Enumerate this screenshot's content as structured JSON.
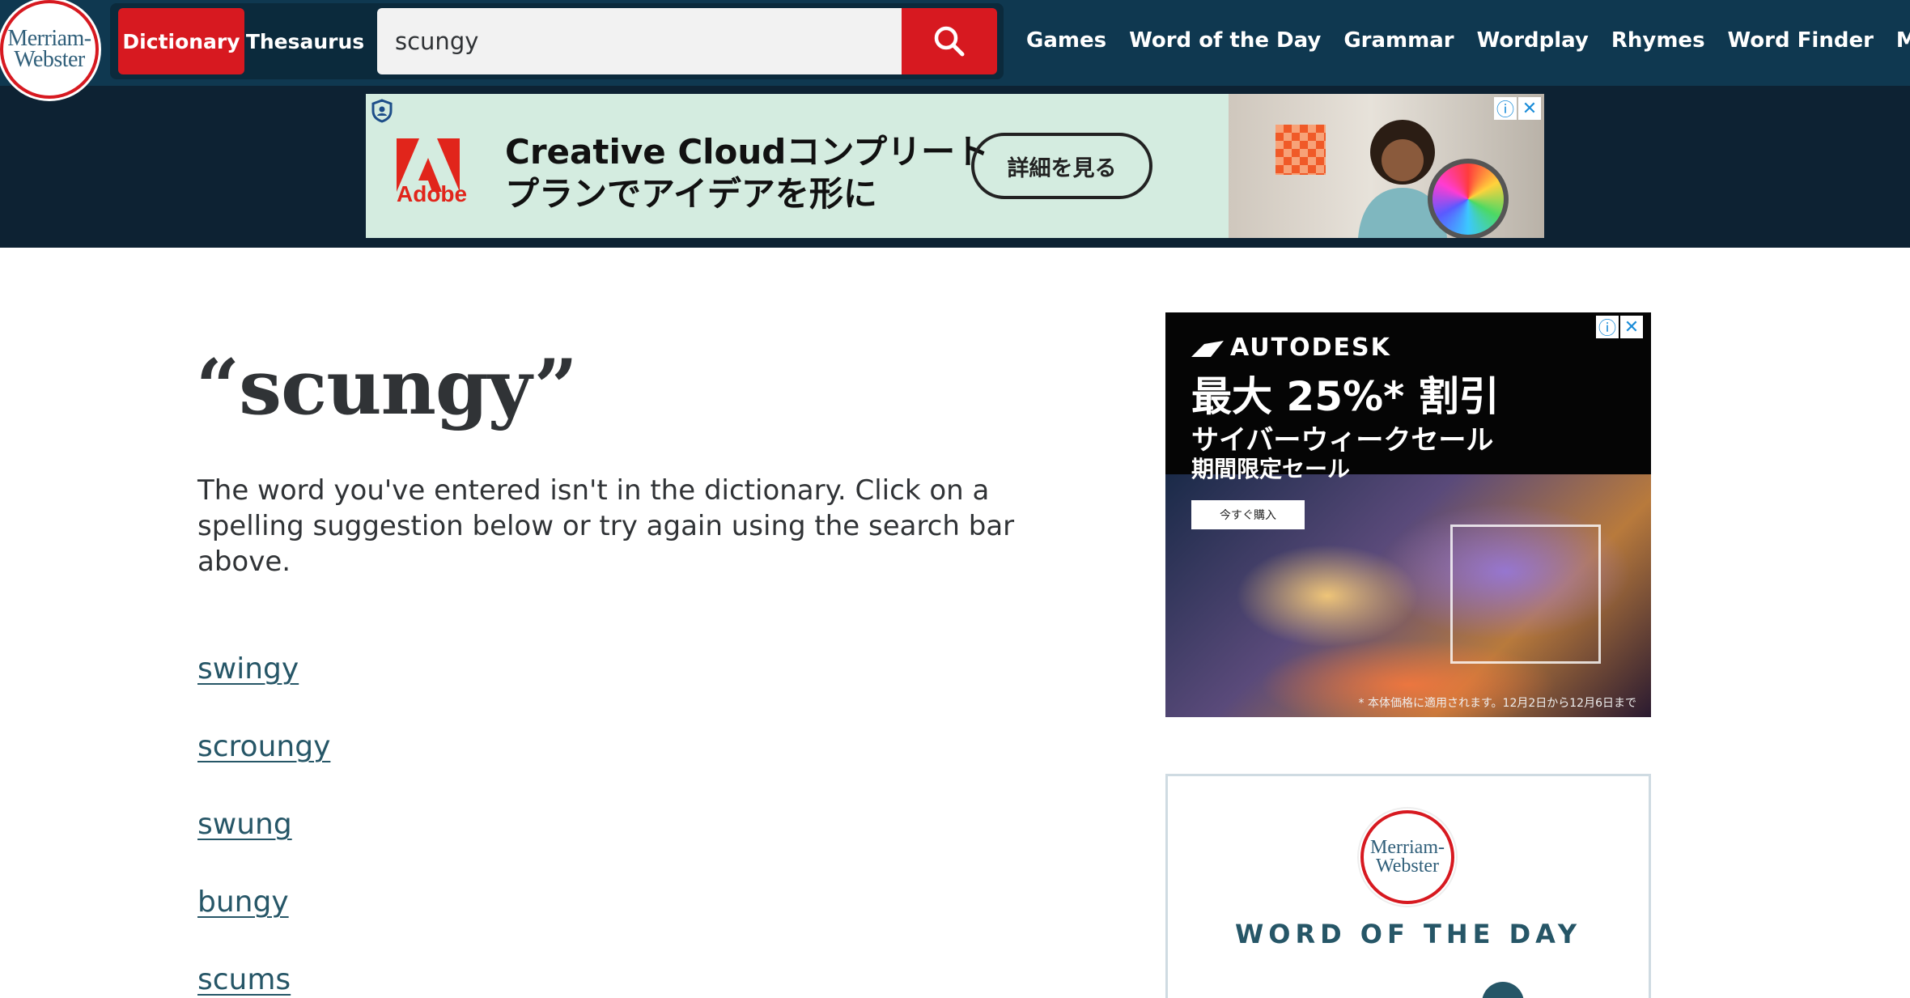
{
  "logo": {
    "line1": "Merriam-",
    "line2": "Webster"
  },
  "search": {
    "tab_dictionary": "Dictionary",
    "tab_thesaurus": "Thesaurus",
    "query": "scungy",
    "submit_icon": "search-icon"
  },
  "nav": {
    "items": [
      {
        "label": "Games"
      },
      {
        "label": "Word of the Day"
      },
      {
        "label": "Grammar"
      },
      {
        "label": "Wordplay"
      },
      {
        "label": "Rhymes"
      },
      {
        "label": "Word Finder"
      },
      {
        "label": "More"
      }
    ]
  },
  "ad_top": {
    "brand": "Adobe",
    "line1": "Creative Cloudコンプリート",
    "line2": "プランでアイデアを形に",
    "cta": "詳細を見る"
  },
  "main": {
    "title": "“scungy”",
    "message": "The word you've entered isn't in the dictionary. Click on a spelling suggestion below or try again using the search bar above.",
    "suggestions": [
      "swingy",
      "scroungy",
      "swung",
      "bungy",
      "scums"
    ]
  },
  "ad_side": {
    "brand": "AUTODESK",
    "line1": "最大 25%* 割引",
    "line2": "サイバーウィークセール",
    "line3": "期間限定セール",
    "button": "今すぐ購入",
    "fine_print": "* 本体価格に適用されます。12月2日から12月6日まで"
  },
  "wotd": {
    "logo_line1": "Merriam-",
    "logo_line2": "Webster",
    "title": "WORD OF THE DAY"
  },
  "colors": {
    "header_bg": "#0f3850",
    "accent_red": "#d71920",
    "link": "#265667"
  }
}
